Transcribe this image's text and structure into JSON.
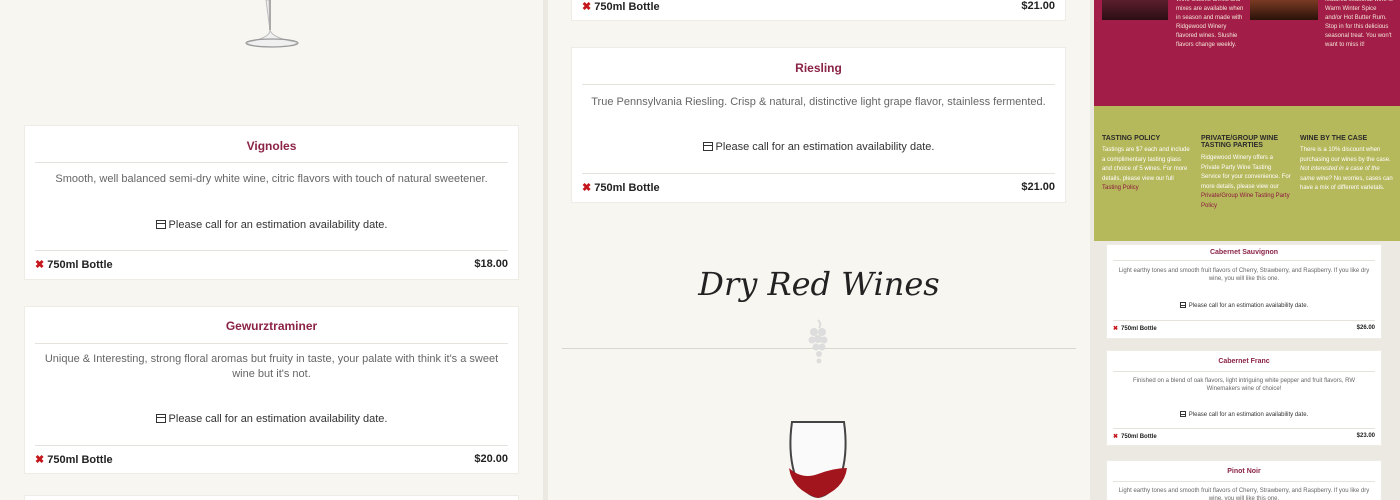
{
  "left_column": {
    "cards": [
      {
        "title": "Vignoles",
        "description": "Smooth, well balanced semi-dry white wine, citric flavors with touch of natural sweetener.",
        "availability": "Please call for an estimation availability date.",
        "bottle": "750ml Bottle",
        "price": "$18.00"
      },
      {
        "title": "Gewurztraminer",
        "description": "Unique & Interesting, strong floral aromas but fruity in taste, your palate with think it's a sweet wine but it's not.",
        "availability": "Please call for an estimation availability date.",
        "bottle": "750ml Bottle",
        "price": "$20.00"
      }
    ]
  },
  "middle_column": {
    "top_row": {
      "bottle": "750ml Bottle",
      "price": "$21.00"
    },
    "card": {
      "title": "Riesling",
      "description": "True Pennsylvania Riesling. Crisp & natural, distinctive light grape flavor, stainless fermented.",
      "availability": "Please call for an estimation availability date.",
      "bottle": "750ml Bottle",
      "price": "$21.00"
    },
    "section_heading": "Dry Red Wines"
  },
  "right_column": {
    "promo": {
      "slushie_text": "Wine Slushie drinks and mixes are available when in season and made with Ridgewood Winery flavored wines. Slushie flavors change weekly.",
      "seasonal_text": "featured seasonal wine is Warm Winter Spice and/or Hot Butter Rum. Stop in for this delicious seasonal treat. You won't want to miss it!"
    },
    "policies": [
      {
        "title": "TASTING POLICY",
        "body": "Tastings are $7 each and include a complimentary tasting glass and choice of 5 wines. For more details, please view our full ",
        "link": "Tasting Policy"
      },
      {
        "title": "PRIVATE/GROUP WINE TASTING PARTIES",
        "body": "Ridgewood Winery offers a Private Party Wine Tasting Service for your convenience. For more details, please view our ",
        "link": "Private/Group Wine Tasting Party Policy"
      },
      {
        "title": "WINE BY THE CASE",
        "body": "There is a 10% discount when purchasing our wines by the case.",
        "italic": "Not interested in a case of the same wine?",
        "body2": "No worries, cases can have a mix of different varietals."
      }
    ],
    "cards": [
      {
        "title": "Cabernet Sauvignon",
        "description": "Light earthy tones and smooth fruit flavors of Cherry, Strawberry, and Raspberry. If you like dry wine, you will like this one.",
        "availability": "Please call for an estimation availability date.",
        "bottle": "750ml Bottle",
        "price": "$26.00"
      },
      {
        "title": "Cabernet Franc",
        "description": "Finished on a blend of oak flavors, light intriguing white pepper and fruit flavors, RW Winemakers wine of choice!",
        "availability": "Please call for an estimation availability date.",
        "bottle": "750ml Bottle",
        "price": "$23.00"
      },
      {
        "title": "Pinot Noir",
        "description": "Light earthy tones and smooth fruit flavors of Cherry, Strawberry, and Raspberry. If you like dry wine, you will like this one."
      }
    ]
  },
  "colors": {
    "accent": "#8b2346",
    "remove": "#c4161c",
    "pink_banner": "#a31d49",
    "green_banner": "#b6b85c"
  }
}
